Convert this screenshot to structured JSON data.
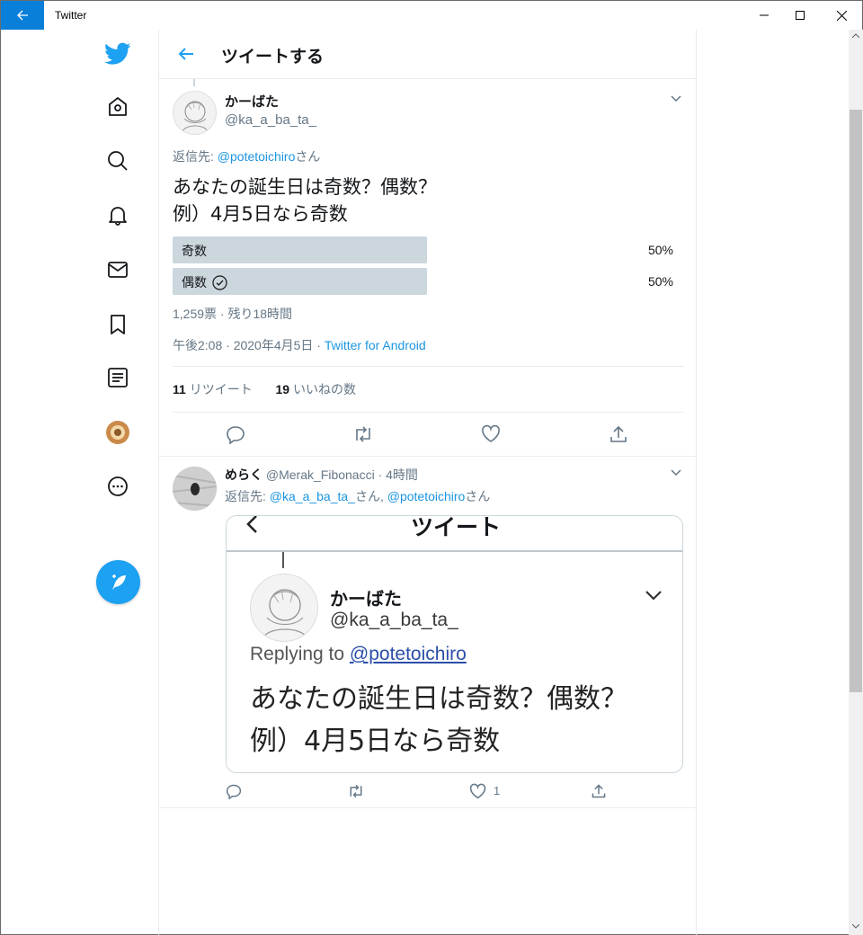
{
  "window": {
    "title": "Twitter"
  },
  "header": {
    "title": "ツイートする"
  },
  "tweet": {
    "name": "かーばた",
    "handle": "@ka_a_ba_ta_",
    "reply_prefix": "返信先: ",
    "reply_to": "@potetoichiro",
    "reply_suffix": "さん",
    "text_line1": "あなたの誕生日は奇数？偶数？",
    "text_line2": "例）4月5日なら奇数",
    "poll": {
      "options": [
        {
          "label": "奇数",
          "percent_text": "50%",
          "percent": 50,
          "selected": false
        },
        {
          "label": "偶数",
          "percent_text": "50%",
          "percent": 50,
          "selected": true
        }
      ],
      "summary": "1,259票 · 残り18時間"
    },
    "timestamp": "午後2:08 · 2020年4月5日 · ",
    "source": "Twitter for Android",
    "retweets_count": "11",
    "retweets_label": " リツイート",
    "likes_count": "19",
    "likes_label": " いいねの数"
  },
  "reply": {
    "name": "めらく",
    "handle": "@Merak_Fibonacci",
    "time": " · 4時間",
    "reply_prefix": "返信先: ",
    "reply_to1": "@ka_a_ba_ta_",
    "reply_mid": "さん, ",
    "reply_to2": "@potetoichiro",
    "reply_suffix": "さん",
    "like_count": "1",
    "embed": {
      "title": "ツイート",
      "name": "かーばた",
      "handle": "@ka_a_ba_ta_",
      "replying_prefix": "Replying to ",
      "replying_to": "@potetoichiro",
      "text_line1": "あなたの誕生日は奇数？偶数？",
      "text_line2": "例）4月5日なら奇数"
    }
  },
  "colors": {
    "accent": "#1da1f2",
    "poll_bar": "#ccd6dd",
    "title_back": "#0a7fd9"
  }
}
